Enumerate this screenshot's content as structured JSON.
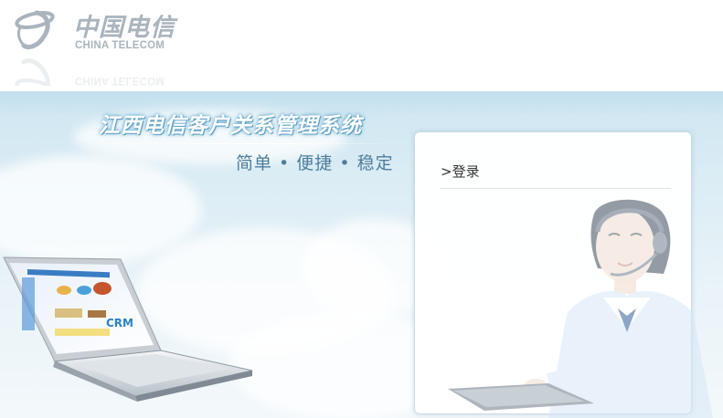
{
  "logo": {
    "cn_name": "中国电信",
    "en_name": "CHINA TELECOM"
  },
  "banner": {
    "title": "江西电信客户关系管理系统",
    "slogan": "简单 • 便捷 • 稳定"
  },
  "login": {
    "heading": ">登录"
  },
  "laptop_screen": {
    "logo_text": "CRM"
  },
  "colors": {
    "brand_gray": "#a9b4bd",
    "sky": "#cfe6f1",
    "slogan": "#4e7d9c",
    "accent": "#2a82c4"
  }
}
